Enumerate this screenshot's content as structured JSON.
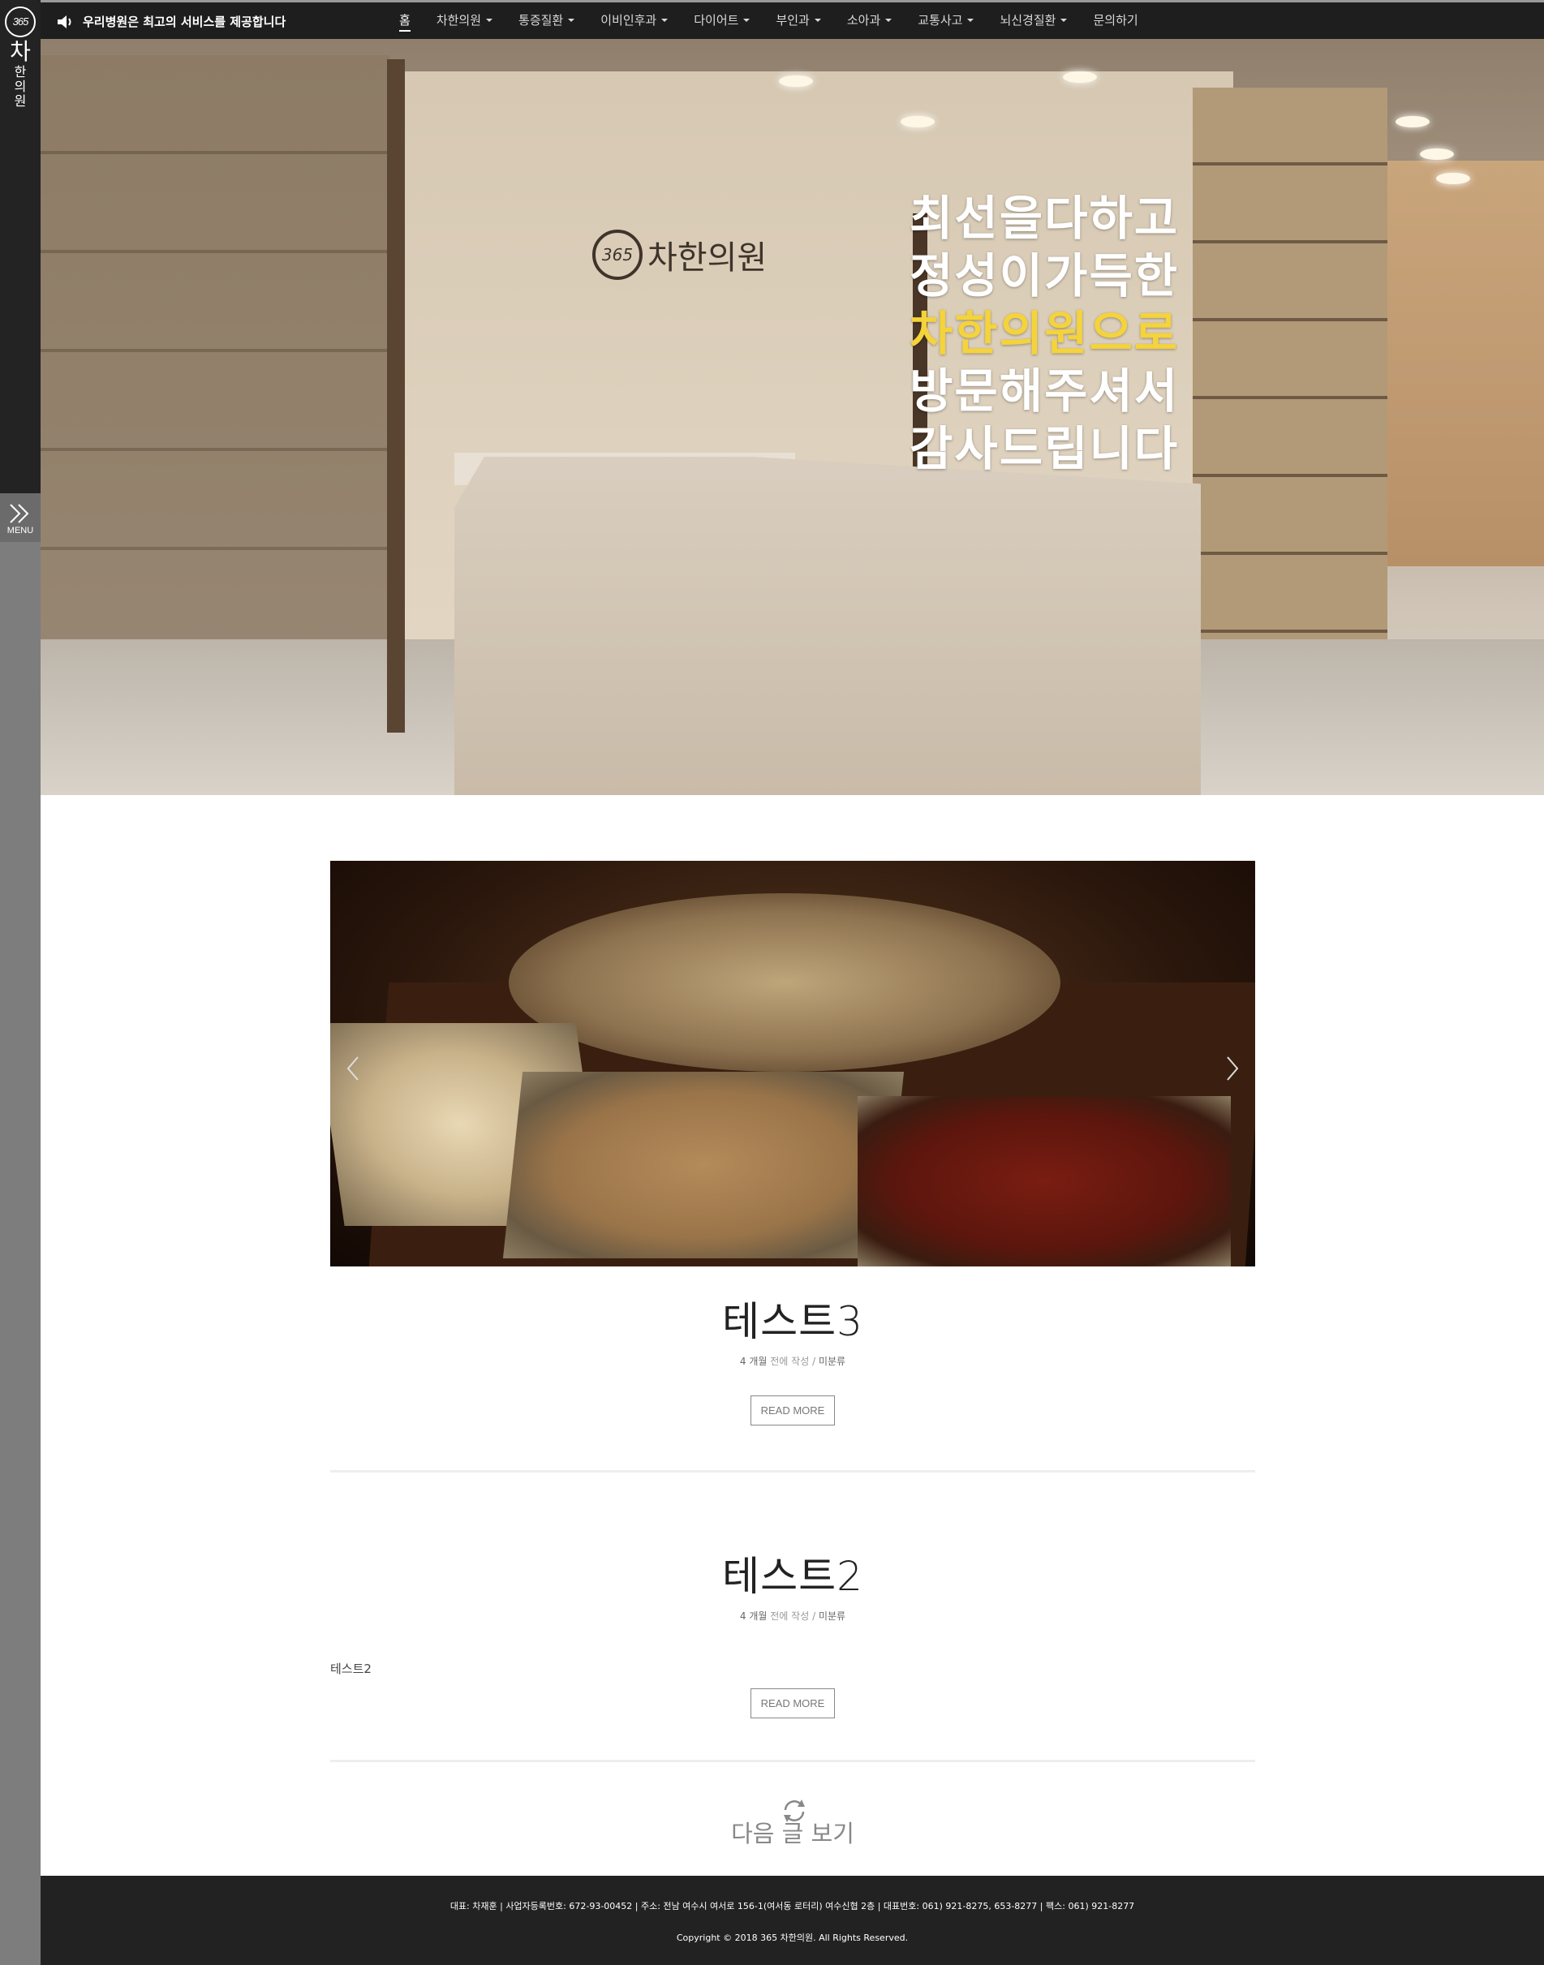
{
  "sidebar": {
    "logo": {
      "number": "365",
      "line1": "차",
      "line2": "한",
      "line3": "의",
      "line4": "원"
    },
    "menu_label": "MENU"
  },
  "topbar": {
    "notice": "우리병원은 최고의 서비스를 제공합니다",
    "nav": [
      {
        "label": "홈",
        "dropdown": false,
        "active": true
      },
      {
        "label": "차한의원",
        "dropdown": true
      },
      {
        "label": "통증질환",
        "dropdown": true
      },
      {
        "label": "이비인후과",
        "dropdown": true
      },
      {
        "label": "다이어트",
        "dropdown": true
      },
      {
        "label": "부인과",
        "dropdown": true
      },
      {
        "label": "소아과",
        "dropdown": true
      },
      {
        "label": "교통사고",
        "dropdown": true
      },
      {
        "label": "뇌신경질환",
        "dropdown": true
      },
      {
        "label": "문의하기",
        "dropdown": false
      }
    ]
  },
  "hero": {
    "sign_number": "365",
    "sign_text": "차한의원",
    "line1": "최선을다하고",
    "line2": "정성이가득한",
    "line3": "차한의원으로",
    "line4": "방문해주셔서",
    "line5": "감사드립니다",
    "highlight_color": "#f5d33a"
  },
  "posts": [
    {
      "title": "테스트3",
      "age": "4 개월",
      "written": "전에 작성",
      "sep": "/",
      "category": "미분류",
      "excerpt": "",
      "read_more": "READ MORE"
    },
    {
      "title": "테스트2",
      "age": "4 개월",
      "written": "전에 작성",
      "sep": "/",
      "category": "미분류",
      "excerpt": "테스트2",
      "read_more": "READ MORE"
    }
  ],
  "load_more": "다음 글 보기",
  "footer": {
    "info": "대표: 차재훈 | 사업자등록번호: 672-93-00452 | 주소: 전남 여수시 여서로 156-1(여서동 로터리) 여수신협 2층 | 대표번호: 061) 921-8275, 653-8277 | 팩스: 061) 921-8277",
    "copyright": "Copyright © 2018 365 차한의원. All Rights Reserved."
  },
  "colors": {
    "sidebar_dark": "#232323",
    "sidebar_grey": "#7d7d7d",
    "topbar": "#1e1e1e",
    "footer": "#222222"
  }
}
